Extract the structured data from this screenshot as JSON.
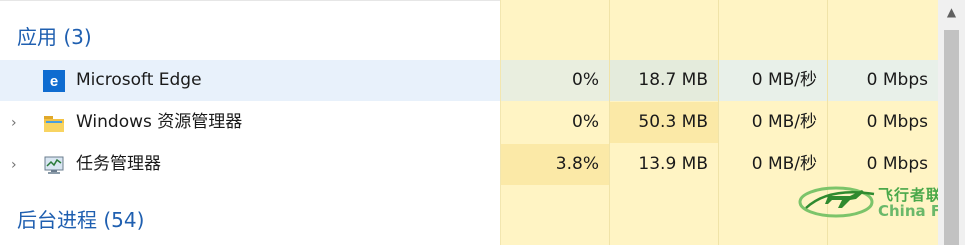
{
  "sections": {
    "apps_title": "应用 (3)",
    "background_title": "后台进程 (54)"
  },
  "apps": [
    {
      "name": "Microsoft Edge",
      "icon": "edge-icon",
      "expandable": false,
      "cpu": "0%",
      "memory": "18.7 MB",
      "disk": "0 MB/秒",
      "network": "0 Mbps"
    },
    {
      "name": "Windows 资源管理器",
      "icon": "folder-icon",
      "expandable": true,
      "cpu": "0%",
      "memory": "50.3 MB",
      "disk": "0 MB/秒",
      "network": "0 Mbps"
    },
    {
      "name": "任务管理器",
      "icon": "task-manager-icon",
      "expandable": true,
      "cpu": "3.8%",
      "memory": "13.9 MB",
      "disk": "0 MB/秒",
      "network": "0 Mbps"
    }
  ],
  "watermark": {
    "text_cn": "飞行者联盟",
    "text_en": "China Flier"
  },
  "colors": {
    "section_title": "#1f5fb0",
    "column_bg": "#fff4c4",
    "hover_bg": "#e8f1fb",
    "watermark_green": "#4aa84a"
  }
}
